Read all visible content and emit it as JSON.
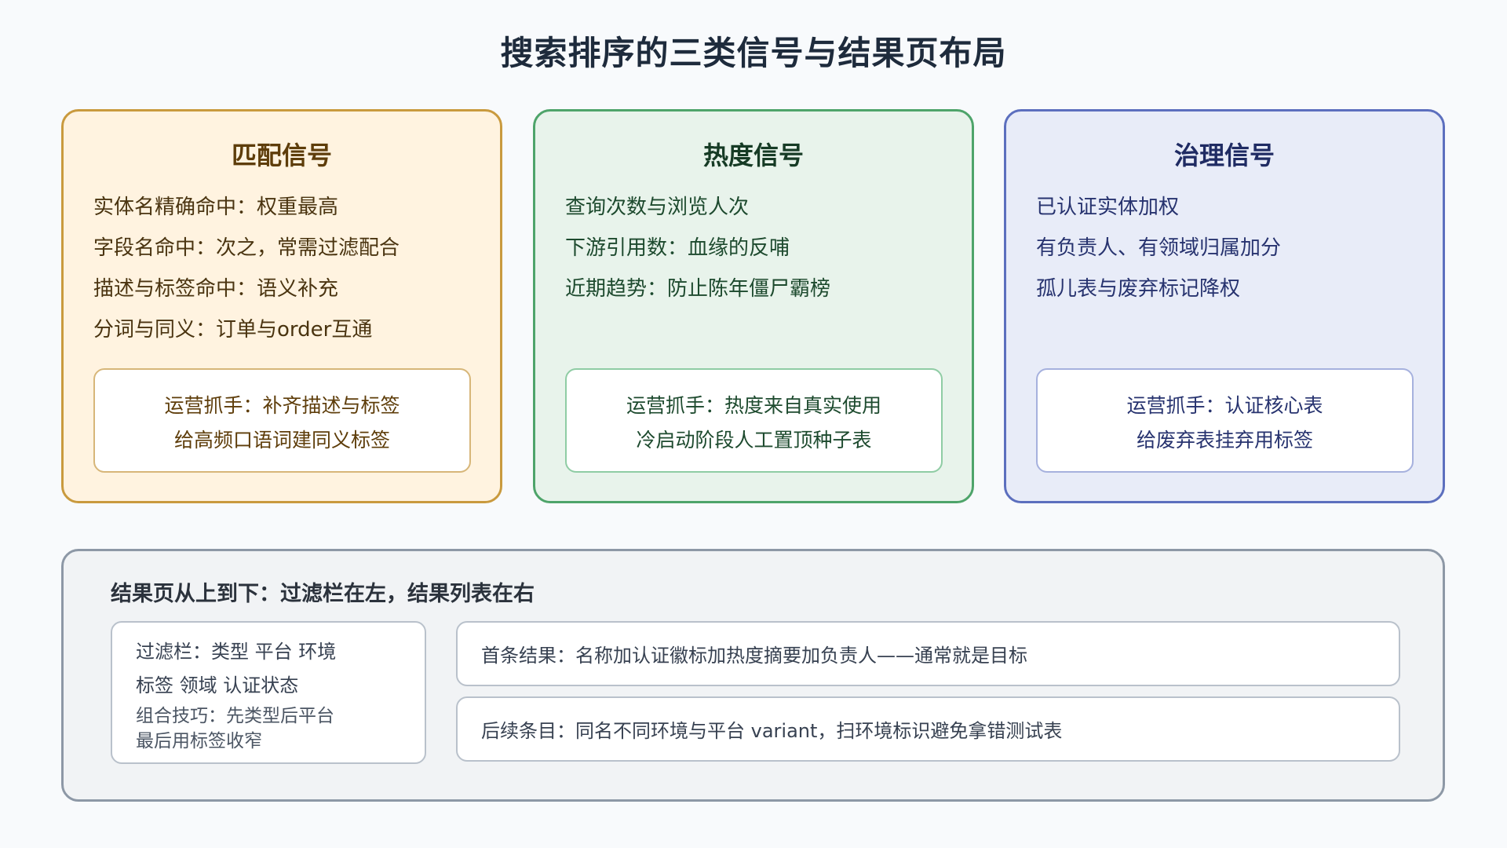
{
  "title": "搜索排序的三类信号与结果页布局",
  "cards": [
    {
      "title": "匹配信号",
      "bullets": [
        "实体名精确命中：权重最高",
        "字段名命中：次之，常需过滤配合",
        "描述与标签命中：语义补充",
        "分词与同义：订单与order互通"
      ],
      "tip": [
        "运营抓手：补齐描述与标签",
        "给高频口语词建同义标签"
      ]
    },
    {
      "title": "热度信号",
      "bullets": [
        "查询次数与浏览人次",
        "下游引用数：血缘的反哺",
        "近期趋势：防止陈年僵尸霸榜"
      ],
      "tip": [
        "运营抓手：热度来自真实使用",
        "冷启动阶段人工置顶种子表"
      ]
    },
    {
      "title": "治理信号",
      "bullets": [
        "已认证实体加权",
        "有负责人、有领域归属加分",
        "孤儿表与废弃标记降权"
      ],
      "tip": [
        "运营抓手：认证核心表",
        "给废弃表挂弃用标签"
      ]
    }
  ],
  "layout": {
    "title": "结果页从上到下：过滤栏在左，结果列表在右",
    "filter": {
      "line1": "过滤栏：类型 平台 环境",
      "line2": "标签 领域 认证状态",
      "tip1": "组合技巧：先类型后平台",
      "tip2": "最后用标签收窄"
    },
    "results": {
      "first": "首条结果：名称加认证徽标加热度摘要加负责人——通常就是目标",
      "rest": "后续条目：同名不同环境与平台 variant，扫环境标识避免拿错测试表"
    }
  }
}
